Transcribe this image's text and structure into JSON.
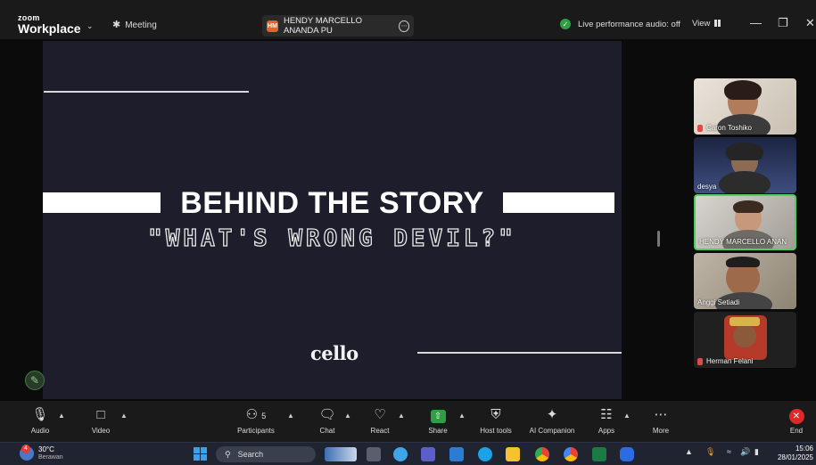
{
  "app": {
    "logo_top": "zoom",
    "logo_bottom": "Workplace",
    "meeting_label": "Meeting",
    "sharer_badge": "HM",
    "sharer_name": "HENDY MARCELLO ANANDA PU",
    "audio_status": "Live performance audio: off",
    "view_label": "View"
  },
  "slide": {
    "title": "BEHIND THE STORY",
    "subtitle": "\"WHAT'S WRONG DEVIL?\"",
    "brand": "cello"
  },
  "participants": [
    {
      "name": "Caron Toshiko",
      "muted": true
    },
    {
      "name": "desya",
      "muted": false
    },
    {
      "name": "HENDY MARCELLO ANAN",
      "muted": false,
      "active": true
    },
    {
      "name": "Anggi Setiadi",
      "muted": false
    },
    {
      "name": "Herman Felani",
      "muted": true
    }
  ],
  "toolbar": {
    "audio": "Audio",
    "video": "Video",
    "participants": "Participants",
    "participants_count": "5",
    "chat": "Chat",
    "react": "React",
    "share": "Share",
    "host_tools": "Host tools",
    "ai_companion": "AI Companion",
    "apps": "Apps",
    "more": "More",
    "end": "End"
  },
  "taskbar": {
    "temperature": "30°C",
    "weather": "Berawan",
    "search": "Search",
    "time": "15:06",
    "date": "28/01/2025"
  },
  "colors": {
    "slide_bg": "#1d1d2b",
    "share_green": "#2ea043",
    "end_red": "#e02828",
    "active_border": "#4ccf5b"
  }
}
